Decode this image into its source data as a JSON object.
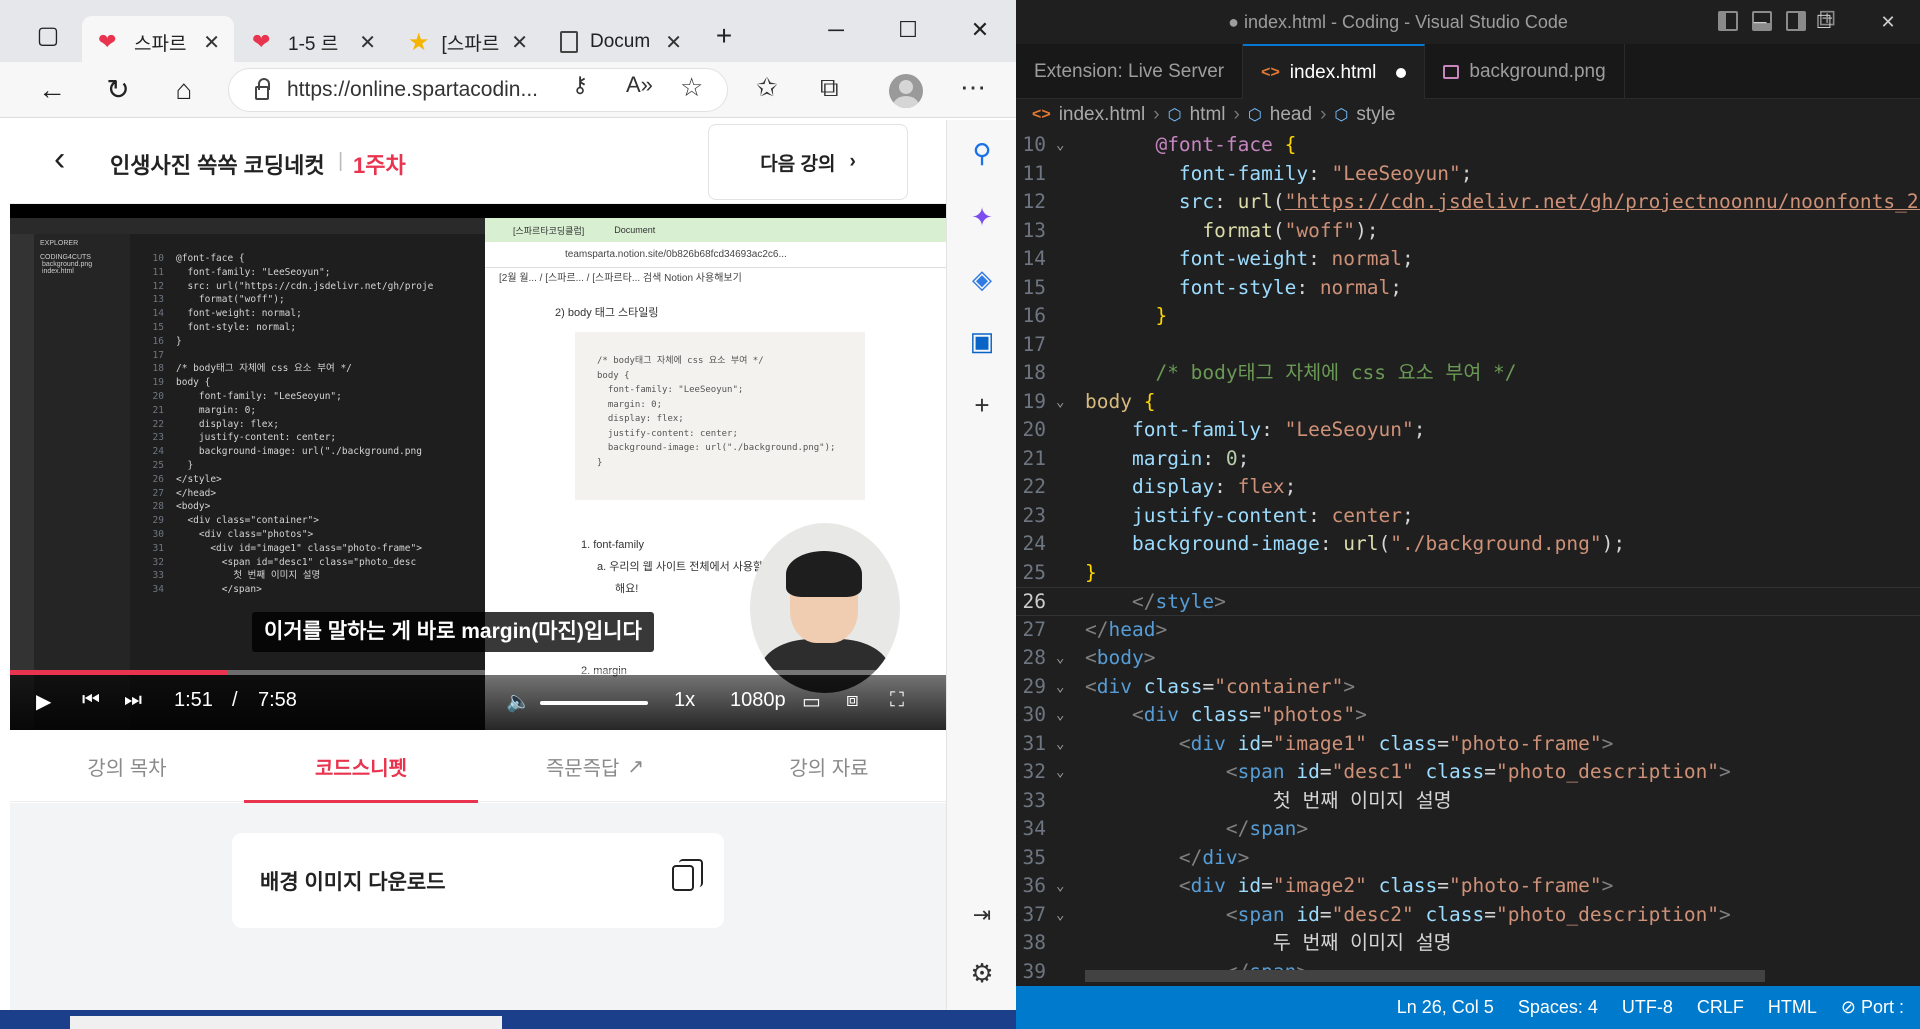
{
  "vscode": {
    "title": "● index.html - Coding - Visual Studio Code",
    "tabs": [
      {
        "label": "Extension: Live Server"
      },
      {
        "label": "index.html"
      },
      {
        "label": "background.png"
      }
    ],
    "breadcrumb": [
      "index.html",
      "html",
      "head",
      "style"
    ],
    "status": {
      "position": "Ln 26, Col 5",
      "spaces": "Spaces: 4",
      "encoding": "UTF-8",
      "eol": "CRLF",
      "language": "HTML",
      "port": "Port :"
    },
    "line_numbers": [
      "10",
      "11",
      "12",
      "13",
      "14",
      "15",
      "16",
      "17",
      "18",
      "19",
      "20",
      "21",
      "22",
      "23",
      "24",
      "25",
      "26",
      "27",
      "28",
      "29",
      "30",
      "31",
      "32",
      "33",
      "34",
      "35",
      "36",
      "37",
      "38",
      "39"
    ]
  },
  "browser": {
    "tabs": [
      {
        "label": "스파르"
      },
      {
        "label": "1-5 르"
      },
      {
        "label": "[스파르"
      },
      {
        "label": "Docum"
      }
    ],
    "url": "https://online.spartacodin...",
    "page": {
      "course_title": "인생사진 쏙쏙 코딩네컷",
      "separator": "|",
      "week": "1주차",
      "next_button": "다음 강의",
      "video": {
        "subtitle": "이거를 말하는 게 바로 margin(마진)입니다",
        "current_time": "1:51",
        "time_sep": "/",
        "duration": "7:58",
        "speed": "1x",
        "quality": "1080p",
        "progress": 0.232,
        "inner_vscode_lines": [
          {
            "n": "10",
            "t": "@font-face {"
          },
          {
            "n": "11",
            "t": "  font-family: \"LeeSeoyun\";"
          },
          {
            "n": "12",
            "t": "  src: url(\"https://cdn.jsdelivr.net/gh/proje"
          },
          {
            "n": "13",
            "t": "    format(\"woff\");"
          },
          {
            "n": "14",
            "t": "  font-weight: normal;"
          },
          {
            "n": "15",
            "t": "  font-style: normal;"
          },
          {
            "n": "16",
            "t": "}"
          },
          {
            "n": "17",
            "t": ""
          },
          {
            "n": "18",
            "t": "/* body태그 자체에 css 요소 부여 */"
          },
          {
            "n": "19",
            "t": "body {"
          },
          {
            "n": "20",
            "t": "    font-family: \"LeeSeoyun\";"
          },
          {
            "n": "21",
            "t": "    margin: 0;"
          },
          {
            "n": "22",
            "t": "    display: flex;"
          },
          {
            "n": "23",
            "t": "    justify-content: center;"
          },
          {
            "n": "24",
            "t": "    background-image: url(\"./background.png"
          },
          {
            "n": "25",
            "t": "  }"
          },
          {
            "n": "26",
            "t": "</style>"
          },
          {
            "n": "27",
            "t": "</head>"
          },
          {
            "n": "28",
            "t": "<body>"
          },
          {
            "n": "29",
            "t": "  <div class=\"container\">"
          },
          {
            "n": "30",
            "t": "    <div class=\"photos\">"
          },
          {
            "n": "31",
            "t": "      <div id=\"image1\" class=\"photo-frame\">"
          },
          {
            "n": "32",
            "t": "        <span id=\"desc1\" class=\"photo_desc"
          },
          {
            "n": "33",
            "t": "          첫 번째 이미지 설명"
          },
          {
            "n": "34",
            "t": "        </span>"
          }
        ],
        "inner_browser": {
          "tab1": "[스파르타코딩클럽]",
          "tab2": "Document",
          "url": "teamsparta.notion.site/0b826b68fcd34693ac2c6...",
          "crumbs": "[2월 월... / [스파르... / [스파르타...   검색   Notion 사용해보기",
          "heading": "2) body 태그 스타일링",
          "code": "/* body태그 자체에 css 요소 부여 */\nbody {\n  font-family: \"LeeSeoyun\";\n  margin: 0;\n  display: flex;\n  justify-content: center;\n  background-image: url(\"./background.png\");\n}",
          "list1": "1.  font-family",
          "list1a": "a.  우리의 웹 사이트 전체에서 사용할 폰트를 정의",
          "list1b": "해요!",
          "list2": "2.  margin"
        }
      },
      "lecture_tabs": [
        {
          "label": "강의 목차"
        },
        {
          "label": "코드스니펫"
        },
        {
          "label": "즉문즉답"
        },
        {
          "label": "강의 자료"
        }
      ],
      "snippet_title": "배경 이미지 다운로드"
    }
  }
}
